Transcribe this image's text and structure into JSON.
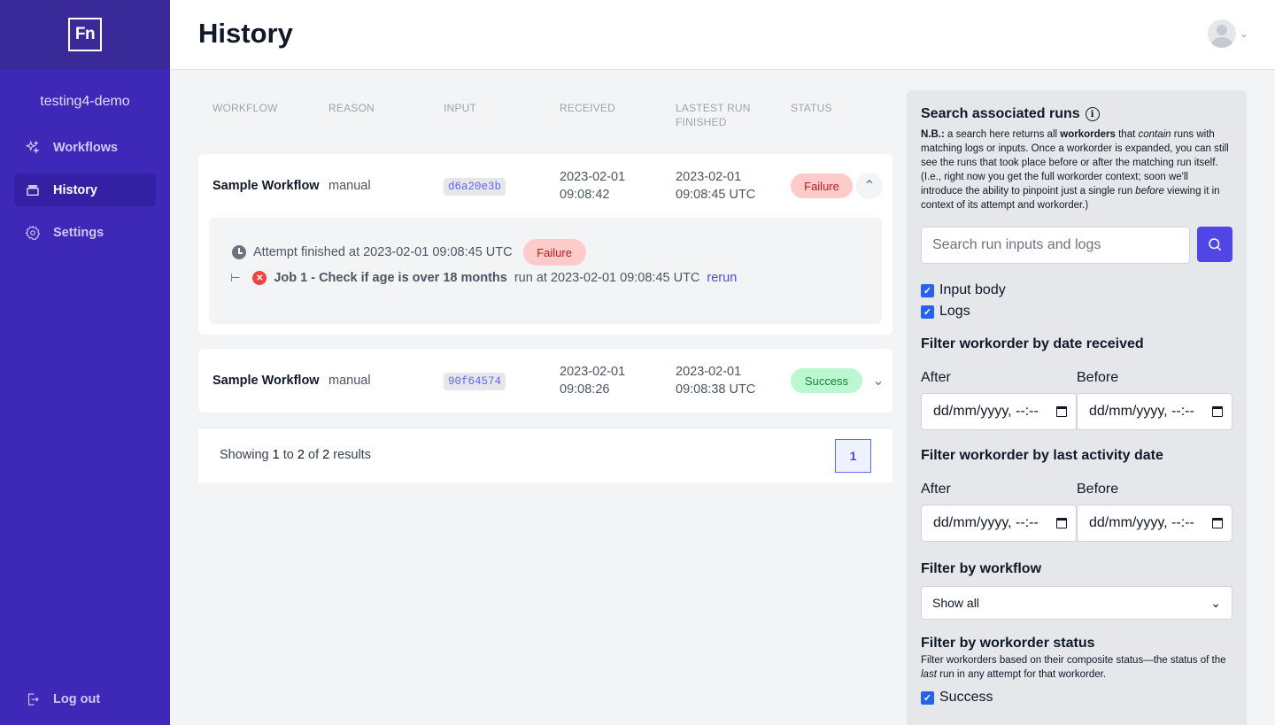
{
  "sidebar": {
    "logo": "Fn",
    "project": "testing4-demo",
    "items": [
      {
        "label": "Workflows",
        "icon": "sparkles-icon"
      },
      {
        "label": "History",
        "icon": "archive-icon"
      },
      {
        "label": "Settings",
        "icon": "gear-icon"
      }
    ],
    "logout": "Log out"
  },
  "header": {
    "title": "History"
  },
  "table": {
    "columns": [
      "WORKFLOW",
      "REASON",
      "INPUT",
      "RECEIVED",
      "LASTEST RUN",
      "FINISHED",
      "STATUS"
    ],
    "rows": [
      {
        "workflow": "Sample Workflow",
        "reason": "manual",
        "input": "d6a20e3b",
        "received_date": "2023-02-01",
        "received_time": "09:08:42",
        "finished_date": "2023-02-01",
        "finished_time": "09:08:45 UTC",
        "status": "Failure",
        "attempt": {
          "text": "Attempt finished at 2023-02-01 09:08:45 UTC",
          "status": "Failure",
          "job_name": "Job 1 - Check if age is over 18 months",
          "job_run": "run at 2023-02-01 09:08:45 UTC",
          "rerun": "rerun"
        }
      },
      {
        "workflow": "Sample Workflow",
        "reason": "manual",
        "input": "90f64574",
        "received_date": "2023-02-01",
        "received_time": "09:08:26",
        "finished_date": "2023-02-01",
        "finished_time": "09:08:38 UTC",
        "status": "Success"
      }
    ]
  },
  "pager": {
    "prefix": "Showing",
    "from": "1",
    "to_word": "to",
    "to": "2",
    "of_word": "of",
    "total": "2",
    "suffix": "results",
    "page": "1"
  },
  "panel": {
    "title": "Search associated runs",
    "note_label": "N.B.:",
    "note_1": "a search here returns all",
    "note_bold": "workorders",
    "note_2": "that",
    "note_em": "contain",
    "note_3": "runs with matching logs or inputs. Once a workorder is expanded, you can still see the runs that took place before or after the matching run itself. (I.e., right now you get the full workorder context; soon we'll introduce the ability to pinpoint just a single run",
    "note_em2": "before",
    "note_4": "viewing it in context of its attempt and workorder.)",
    "search_placeholder": "Search run inputs and logs",
    "checks": [
      "Input body",
      "Logs"
    ],
    "date_received_title": "Filter workorder by date received",
    "activity_title": "Filter workorder by last activity date",
    "after": "After",
    "before": "Before",
    "date_placeholder": "dd/mm/yyyy, --:--",
    "workflow_title": "Filter by workflow",
    "workflow_value": "Show all",
    "status_title": "Filter by workorder status",
    "status_note_1": "Filter workorders based on their composite status—the status of the",
    "status_note_em": "last",
    "status_note_2": "run in any attempt for that workorder.",
    "status_checks": [
      "Success"
    ]
  }
}
